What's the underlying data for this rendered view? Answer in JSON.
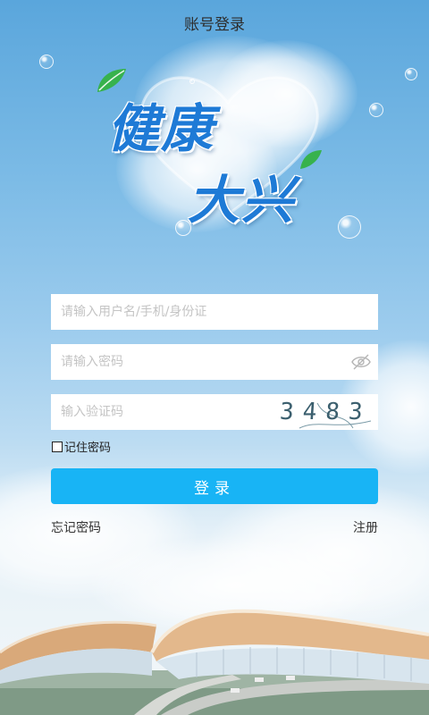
{
  "header": {
    "title": "账号登录"
  },
  "logo": {
    "line1": "健康",
    "line2": "大兴"
  },
  "form": {
    "username_placeholder": "请输入用户名/手机/身份证",
    "password_placeholder": "请输入密码",
    "captcha_placeholder": "输入验证码",
    "captcha_code": "3483",
    "remember_label": "记住密码",
    "login_label": "登录"
  },
  "links": {
    "forgot": "忘记密码",
    "register": "注册"
  },
  "colors": {
    "accent": "#18b4f5",
    "logo_blue": "#1e7ad6",
    "sky": "#7cbbe6"
  }
}
